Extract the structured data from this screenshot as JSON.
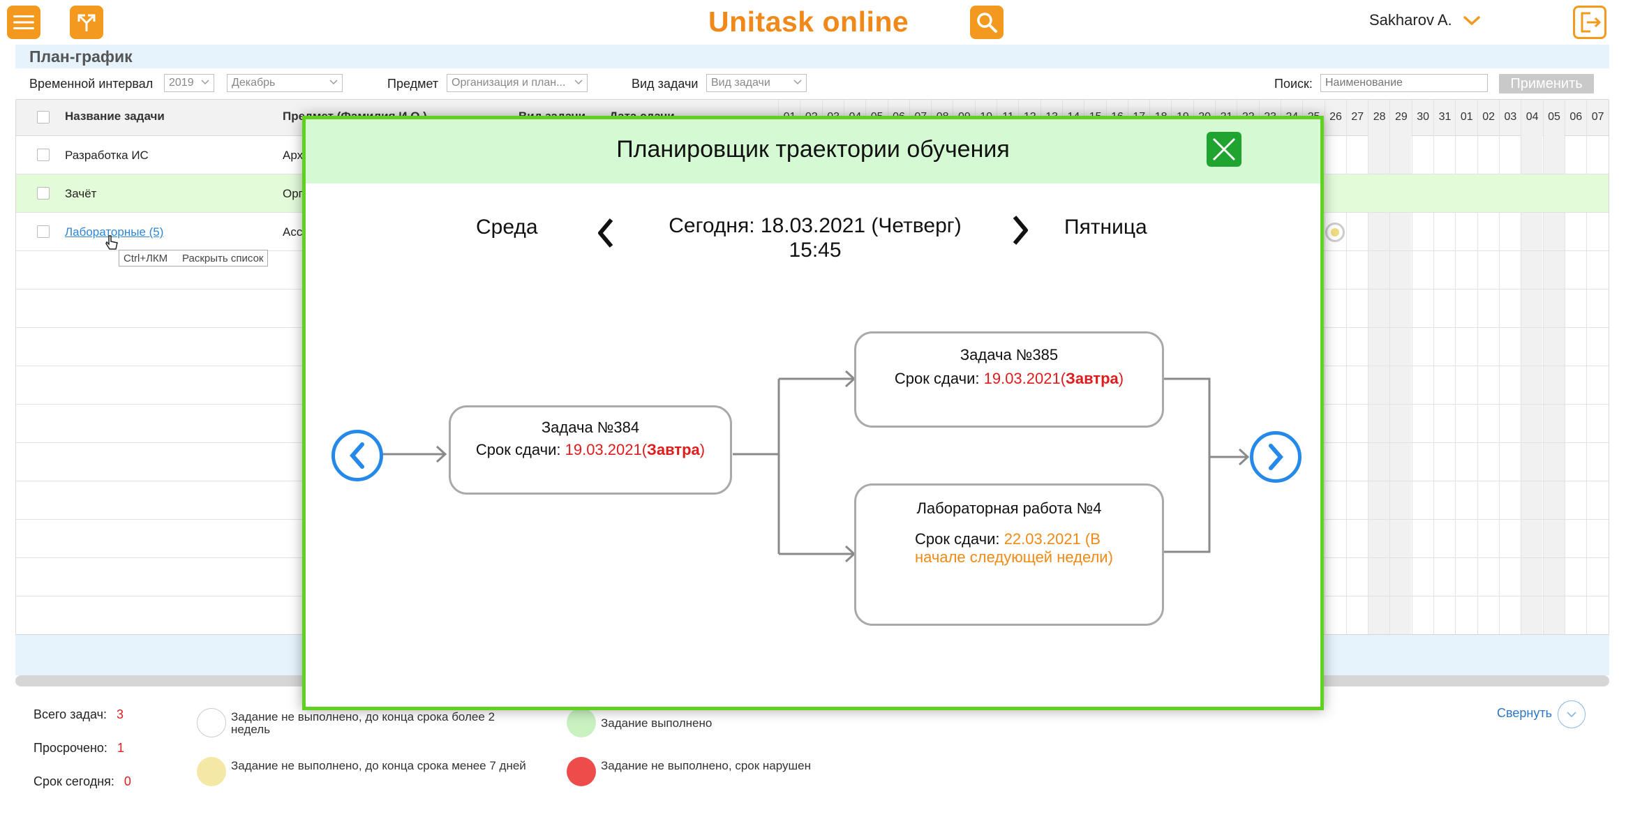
{
  "header": {
    "brand": "Unitask online",
    "user": "Sakharov A."
  },
  "page": {
    "title": "План-график"
  },
  "filters": {
    "interval_label": "Временной интервал",
    "year": "2019",
    "month": "Декабрь",
    "subject_label": "Предмет",
    "subject_value": "Организация и план...",
    "task_type_label": "Вид задачи",
    "task_type_value": "Вид задачи",
    "search_label": "Поиск:",
    "search_placeholder": "Наименование",
    "apply": "Применить"
  },
  "table": {
    "headers": {
      "task_name": "Название задачи",
      "subject": "Предмет (Фамилия И.О.)",
      "task_type": "Вид задачи",
      "date": "Дата сдачи"
    },
    "days": [
      "01",
      "02",
      "03",
      "04",
      "05",
      "06",
      "07",
      "08",
      "09",
      "10",
      "11",
      "12",
      "13",
      "14",
      "15",
      "16",
      "17",
      "18",
      "19",
      "20",
      "21",
      "22",
      "23",
      "24",
      "25",
      "26",
      "27",
      "28",
      "29",
      "30",
      "31",
      "01",
      "02",
      "03",
      "04",
      "05",
      "06",
      "07"
    ],
    "rows": [
      {
        "name": "Разработка ИС",
        "subject": "Арх",
        "highlight": false,
        "link": false
      },
      {
        "name": "Зачёт",
        "subject": "Орг",
        "highlight": true,
        "link": false
      },
      {
        "name": "Лабораторные (5)",
        "subject": "Асс",
        "highlight": false,
        "link": true
      }
    ],
    "tooltip_keys": "Ctrl+ЛКМ",
    "tooltip_text": "Раскрыть список"
  },
  "legend": {
    "total_label": "Всего задач:",
    "total_value": "3",
    "overdue_label": "Просрочено:",
    "overdue_value": "1",
    "today_label": "Срок сегодня:",
    "today_value": "0",
    "items": [
      {
        "text": "Задание не выполнено, до конца срока более 2 недель",
        "color": "#ffffff"
      },
      {
        "text": "Задание не выполнено, до конца срока менее 7 дней",
        "color": "#f5e8a6"
      },
      {
        "text": "Задание выполнено",
        "color": "#c9f2c0"
      },
      {
        "text": "Задание не выполнено, срок нарушен",
        "color": "#ee4b4b"
      }
    ],
    "collapse": "Свернуть"
  },
  "modal": {
    "title": "Планировщик траектории обучения",
    "prev_day": "Среда",
    "today_line1": "Сегодня: 18.03.2021 (Четверг)",
    "today_line2": "15:45",
    "next_day": "Пятница",
    "tasks": [
      {
        "title": "Задача №384",
        "deadline_label": "Срок сдачи:",
        "date": "19.03.2021",
        "note_open": "(",
        "note": "Завтра",
        "note_close": ")"
      },
      {
        "title": "Задача №385",
        "deadline_label": "Срок сдачи:",
        "date": "19.03.2021",
        "note_open": "(",
        "note": "Завтра",
        "note_close": ")"
      },
      {
        "title": "Лабораторная работа №4",
        "deadline_label": "Срок сдачи:",
        "date": "22.03.2021",
        "note_line1": "(В",
        "note_line2": "начале следующей недели)"
      }
    ]
  },
  "colors": {
    "brand_orange": "#f39a1e",
    "modal_border": "#5fd11e",
    "modal_header": "#d5f9d3",
    "close_green": "#1fa52f",
    "nav_blue": "#2489e8",
    "alert_red": "#e01b1b",
    "note_orange": "#ef8a16"
  }
}
